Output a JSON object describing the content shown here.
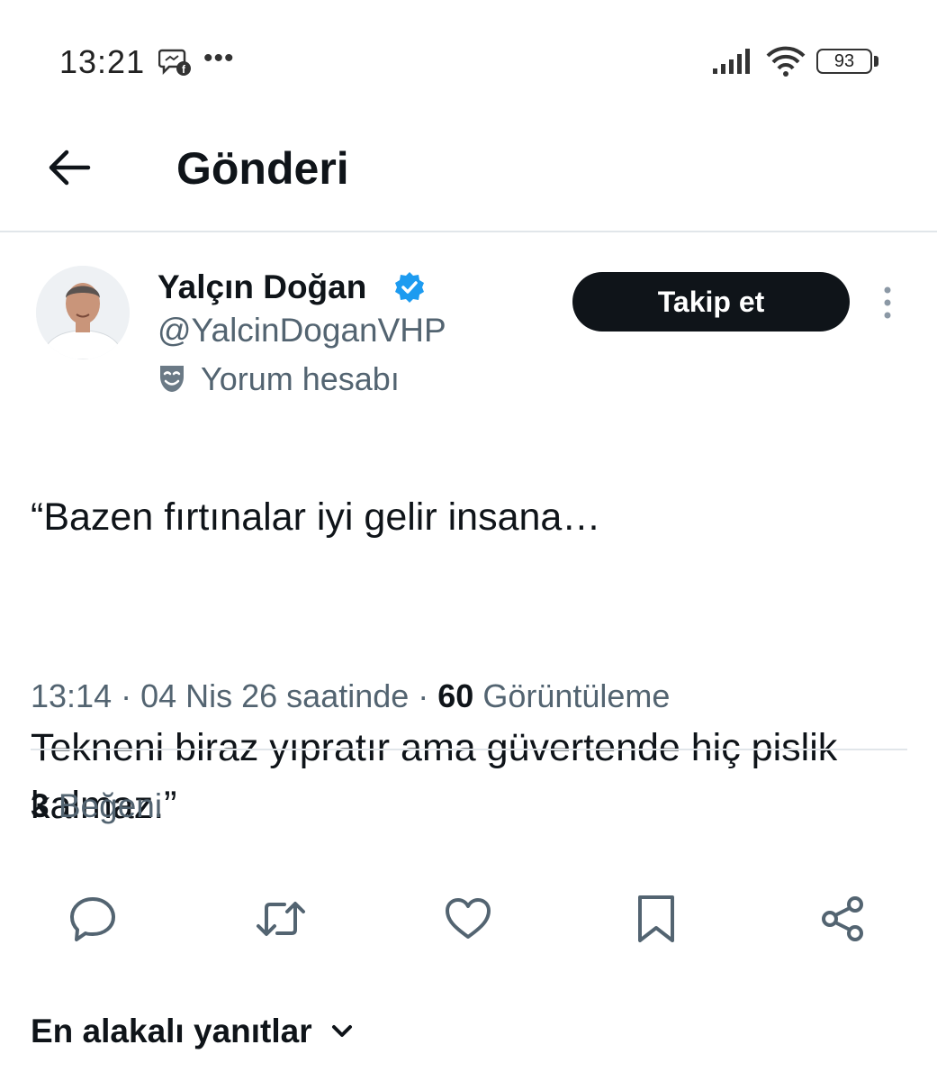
{
  "status_bar": {
    "time": "13:21",
    "dots": "•••",
    "battery_level": "93",
    "icons": [
      "messenger-icon",
      "signal-icon",
      "wifi-icon",
      "battery-icon"
    ]
  },
  "header": {
    "title": "Gönderi",
    "back_icon": "arrow-left-icon"
  },
  "author": {
    "name": "Yalçın Doğan",
    "handle": "@YalcinDoganVHP",
    "account_label": "Yorum hesabı",
    "verified": true,
    "verified_color": "#1d9bf0"
  },
  "follow_button": {
    "label": "Takip et"
  },
  "tweet": {
    "line1": "“Bazen fırtınalar iyi gelir insana…",
    "line2": "Tekneni biraz yıpratır ama güvertende hiç pislik kalmaz.”",
    "meta_time": "13:14 · 04 Nis 26 saatinde · ",
    "views_count": "60",
    "views_label": " Görüntüleme"
  },
  "stats": {
    "likes_count": "3",
    "likes_label": " Beğeni"
  },
  "actions": [
    "reply-icon",
    "retweet-icon",
    "like-icon",
    "bookmark-icon",
    "share-icon"
  ],
  "replies": {
    "sort_label": "En alakalı yanıtlar"
  },
  "colors": {
    "text_primary": "#0f1419",
    "text_secondary": "#536471",
    "divider": "#e1e6ea",
    "action_icon": "#536471",
    "verified_blue": "#1d9bf0"
  }
}
